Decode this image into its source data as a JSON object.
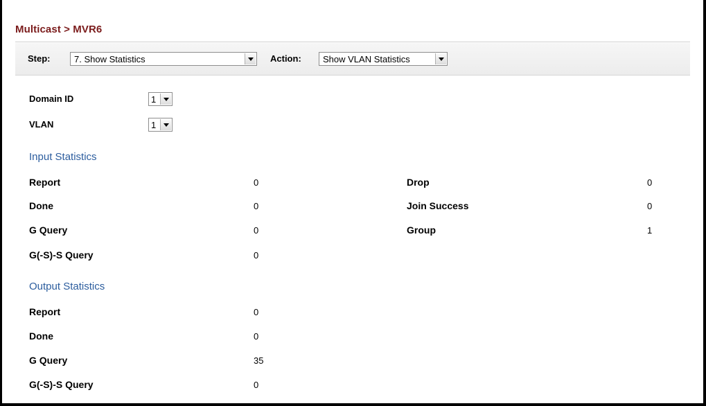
{
  "breadcrumb": "Multicast > MVR6",
  "toolbar": {
    "step_label": "Step:",
    "step_value": "7. Show Statistics",
    "action_label": "Action:",
    "action_value": "Show VLAN Statistics"
  },
  "form": {
    "domain_id_label": "Domain ID",
    "domain_id_value": "1",
    "vlan_label": "VLAN",
    "vlan_value": "1"
  },
  "input_statistics": {
    "title": "Input Statistics",
    "left": [
      {
        "label": "Report",
        "value": "0"
      },
      {
        "label": "Done",
        "value": "0"
      },
      {
        "label": "G Query",
        "value": "0"
      },
      {
        "label": "G(-S)-S Query",
        "value": "0"
      }
    ],
    "right": [
      {
        "label": "Drop",
        "value": "0"
      },
      {
        "label": "Join Success",
        "value": "0"
      },
      {
        "label": "Group",
        "value": "1"
      }
    ]
  },
  "output_statistics": {
    "title": "Output Statistics",
    "rows": [
      {
        "label": "Report",
        "value": "0"
      },
      {
        "label": "Done",
        "value": "0"
      },
      {
        "label": "G Query",
        "value": "35"
      },
      {
        "label": "G(-S)-S Query",
        "value": "0"
      }
    ]
  }
}
